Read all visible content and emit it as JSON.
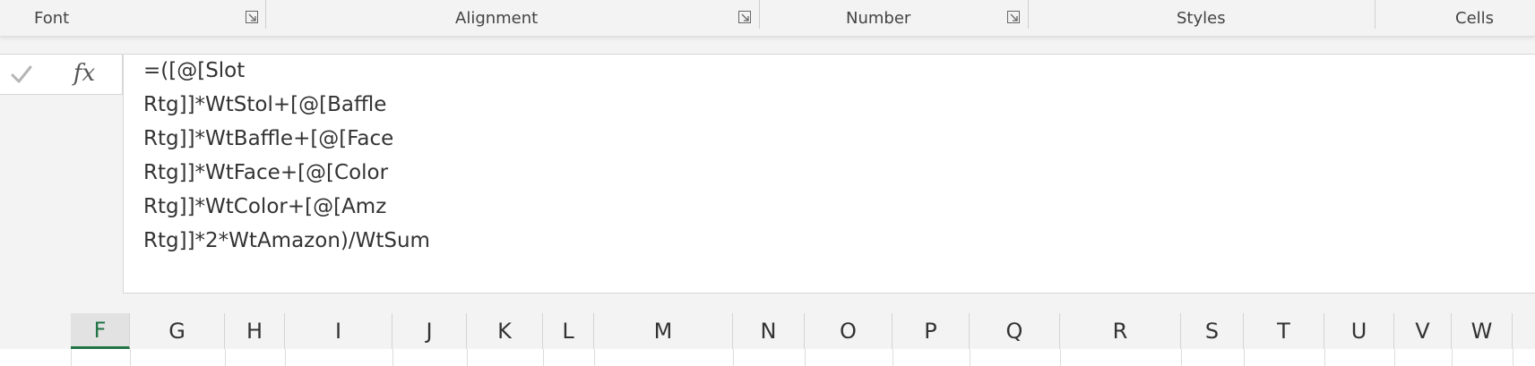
{
  "ribbon": {
    "groups": [
      {
        "label": "Font"
      },
      {
        "label": "Alignment"
      },
      {
        "label": "Number"
      },
      {
        "label": "Styles"
      },
      {
        "label": "Cells"
      }
    ]
  },
  "formula_bar": {
    "fx_symbol": "fx",
    "lines": [
      "=([@[Slot",
      "Rtg]]*WtStol+[@[Baffle",
      "Rtg]]*WtBaffle+[@[Face",
      "Rtg]]*WtFace+[@[Color",
      "Rtg]]*WtColor+[@[Amz",
      "Rtg]]*2*WtAmazon)/WtSum"
    ]
  },
  "columns": [
    "F",
    "G",
    "H",
    "I",
    "J",
    "K",
    "L",
    "M",
    "N",
    "O",
    "P",
    "Q",
    "R",
    "S",
    "T",
    "U",
    "V",
    "W"
  ],
  "selected_column": "F",
  "colors": {
    "accent": "#217346"
  },
  "icons": {
    "launcher": "dialog-launcher-icon",
    "enter": "checkmark-icon"
  }
}
